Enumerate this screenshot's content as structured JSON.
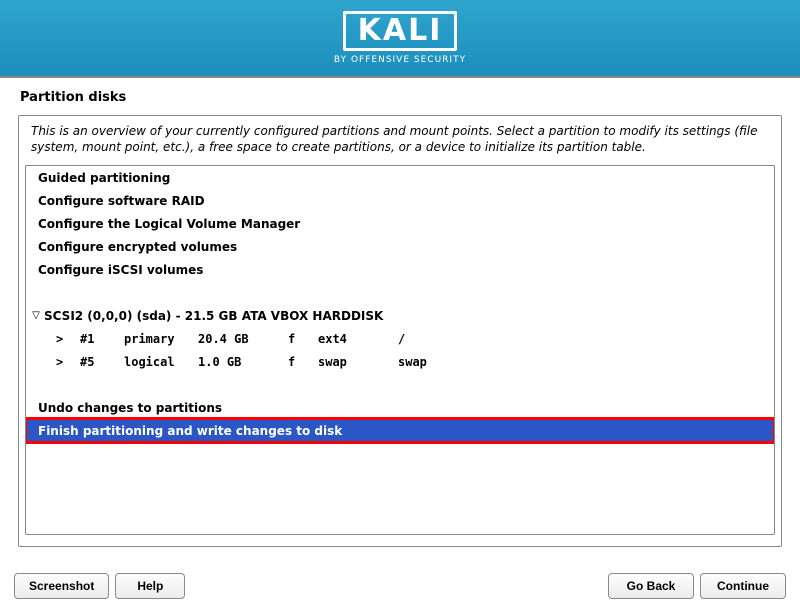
{
  "branding": {
    "logo": "KALI",
    "tagline": "BY OFFENSIVE SECURITY"
  },
  "page_title": "Partition disks",
  "description": "This is an overview of your currently configured partitions and mount points. Select a partition to modify its settings (file system, mount point, etc.), a free space to create partitions, or a device to initialize its partition table.",
  "menu": {
    "guided": "Guided partitioning",
    "raid": "Configure software RAID",
    "lvm": "Configure the Logical Volume Manager",
    "encrypted": "Configure encrypted volumes",
    "iscsi": "Configure iSCSI volumes"
  },
  "disk": {
    "label": "SCSI2 (0,0,0) (sda) - 21.5 GB ATA VBOX HARDDISK",
    "partitions": [
      {
        "indicator": ">",
        "num": "#1",
        "ptype": "primary",
        "size": "20.4 GB",
        "flag": "f",
        "fs": "ext4",
        "mount": "/"
      },
      {
        "indicator": ">",
        "num": "#5",
        "ptype": "logical",
        "size": "1.0 GB",
        "flag": "f",
        "fs": "swap",
        "mount": "swap"
      }
    ]
  },
  "actions": {
    "undo": "Undo changes to partitions",
    "finish": "Finish partitioning and write changes to disk"
  },
  "footer": {
    "screenshot": "Screenshot",
    "help": "Help",
    "goback": "Go Back",
    "continue": "Continue"
  }
}
